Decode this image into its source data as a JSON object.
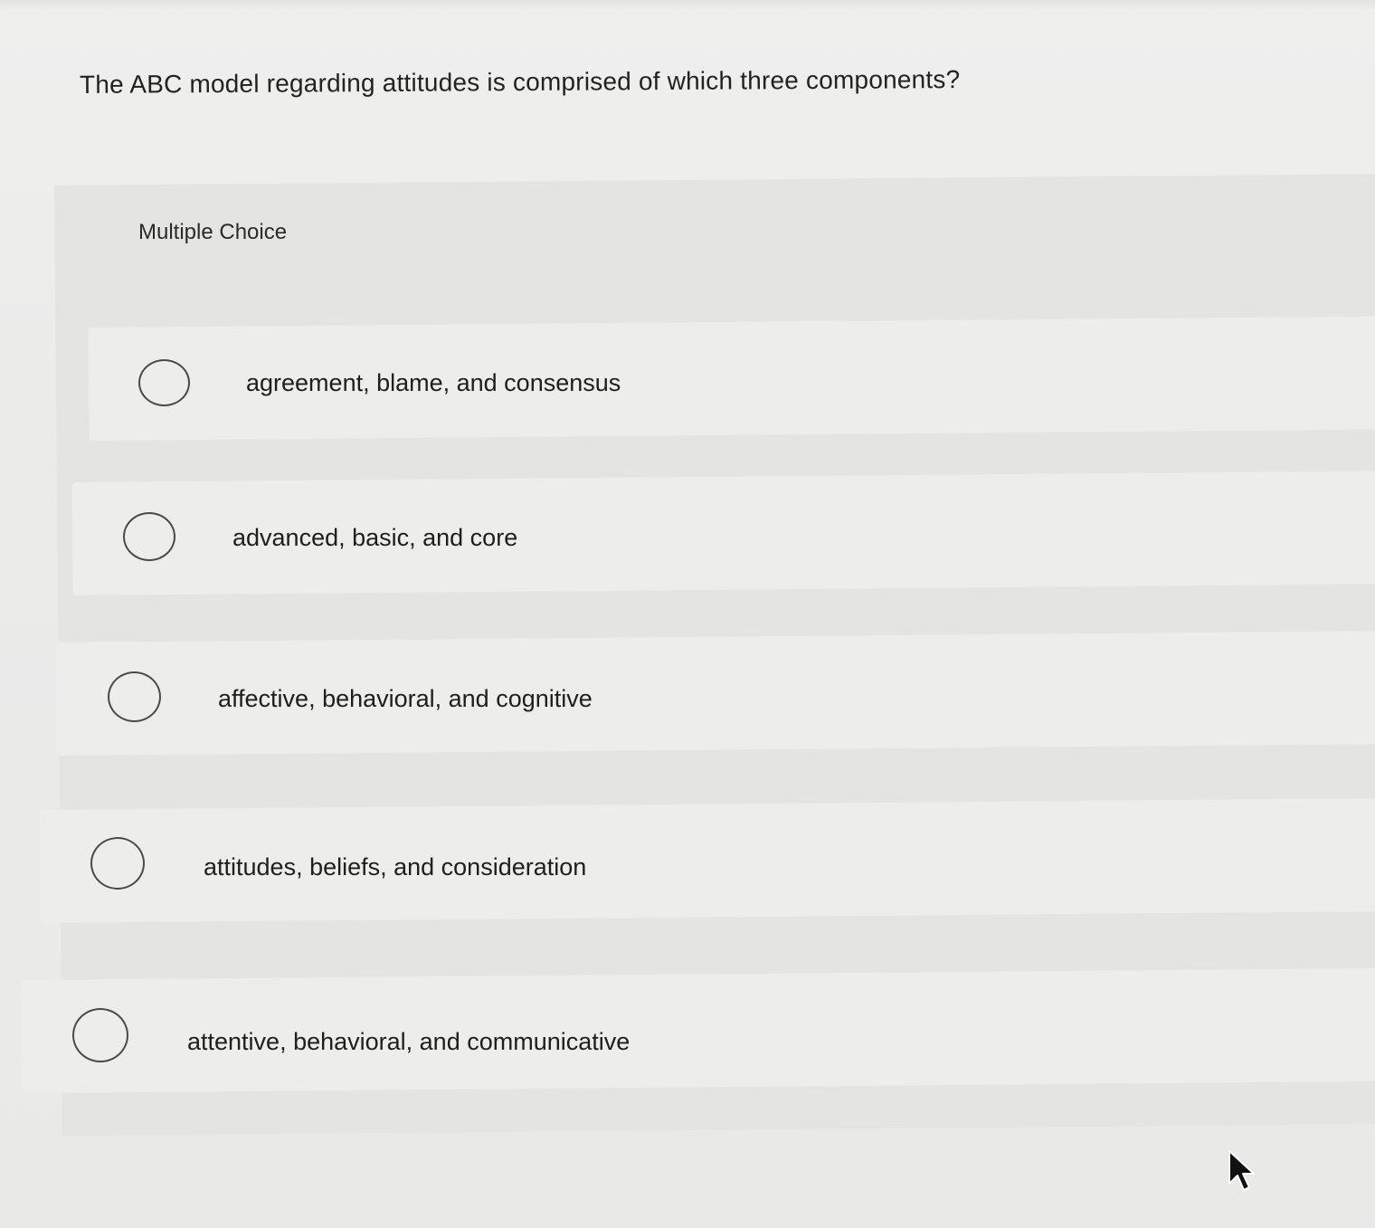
{
  "question": {
    "text": "The ABC model regarding attitudes is comprised of which three components?"
  },
  "multiple_choice": {
    "header": "Multiple Choice",
    "options": [
      {
        "label": "agreement, blame, and consensus",
        "selected": false
      },
      {
        "label": "advanced, basic, and core",
        "selected": false
      },
      {
        "label": "affective, behavioral, and cognitive",
        "selected": false
      },
      {
        "label": "attitudes, beliefs, and consideration",
        "selected": false
      },
      {
        "label": "attentive, behavioral, and communicative",
        "selected": false
      }
    ]
  },
  "icons": {
    "radio": "radio-circle-icon",
    "cursor": "mouse-pointer-icon"
  },
  "colors": {
    "background": "#ebebea",
    "panel": "#e4e4e3",
    "option_card": "#ededec",
    "radio_border": "#4a4a4a",
    "text": "#1f1f1f"
  }
}
